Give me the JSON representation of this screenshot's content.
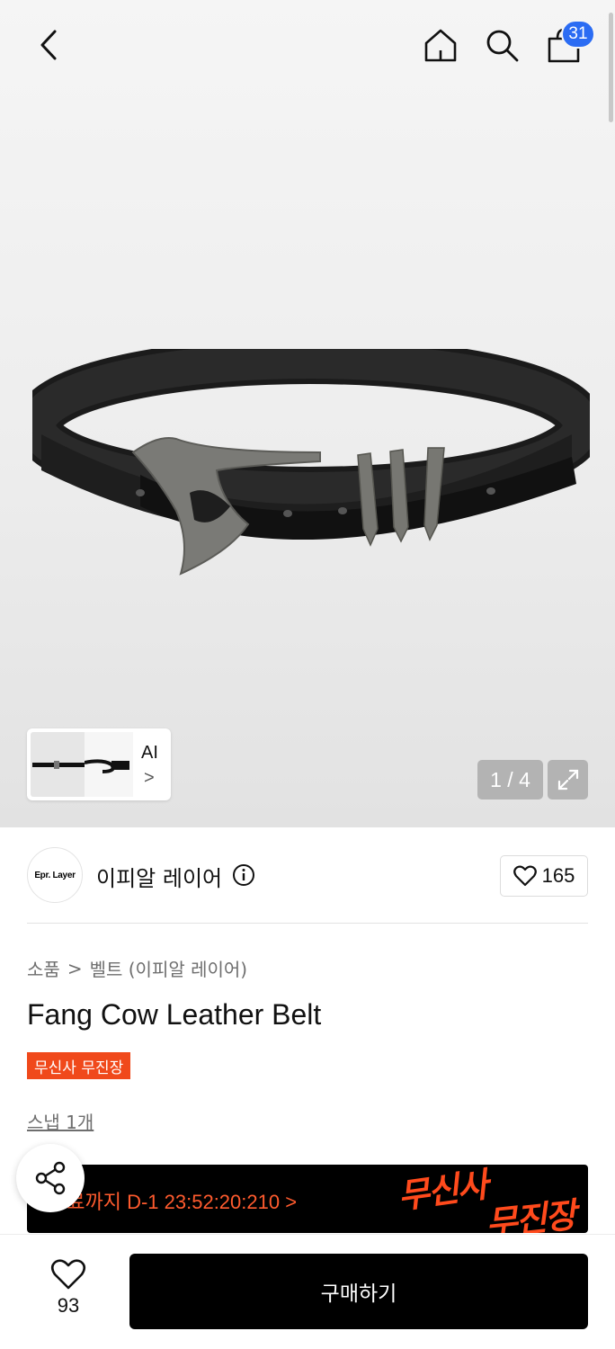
{
  "header": {
    "back_icon": "chevron-left-icon",
    "home_icon": "home-icon",
    "search_icon": "search-icon",
    "cart_icon": "shopping-bag-icon",
    "cart_badge": "31",
    "badge_color": "#2b6cf3"
  },
  "gallery": {
    "ai_label": "AI",
    "ai_chevron": ">",
    "page_counter": "1 / 4",
    "expand_icon": "expand-icon"
  },
  "brand": {
    "logo_text": "Epr. Layer",
    "name": "이피알 레이어",
    "info_icon": "info-icon",
    "like_count": "165"
  },
  "breadcrumb": {
    "items": [
      "소품",
      "벨트 (이피알 레이어)"
    ],
    "separator": ">"
  },
  "product": {
    "title": "Fang Cow Leather Belt",
    "tag": "무신사 무진장",
    "tag_color": "#f0491b",
    "snap_link": "스냅 1개"
  },
  "promo": {
    "countdown": "종료까지 D-1 23:52:20:210 >",
    "logo_line1": "무신사",
    "logo_line2": "무진장",
    "accent": "#ff4a1c"
  },
  "share": {
    "icon": "share-icon"
  },
  "bottom": {
    "wish_icon": "heart-icon",
    "wish_count": "93",
    "buy_label": "구매하기"
  }
}
